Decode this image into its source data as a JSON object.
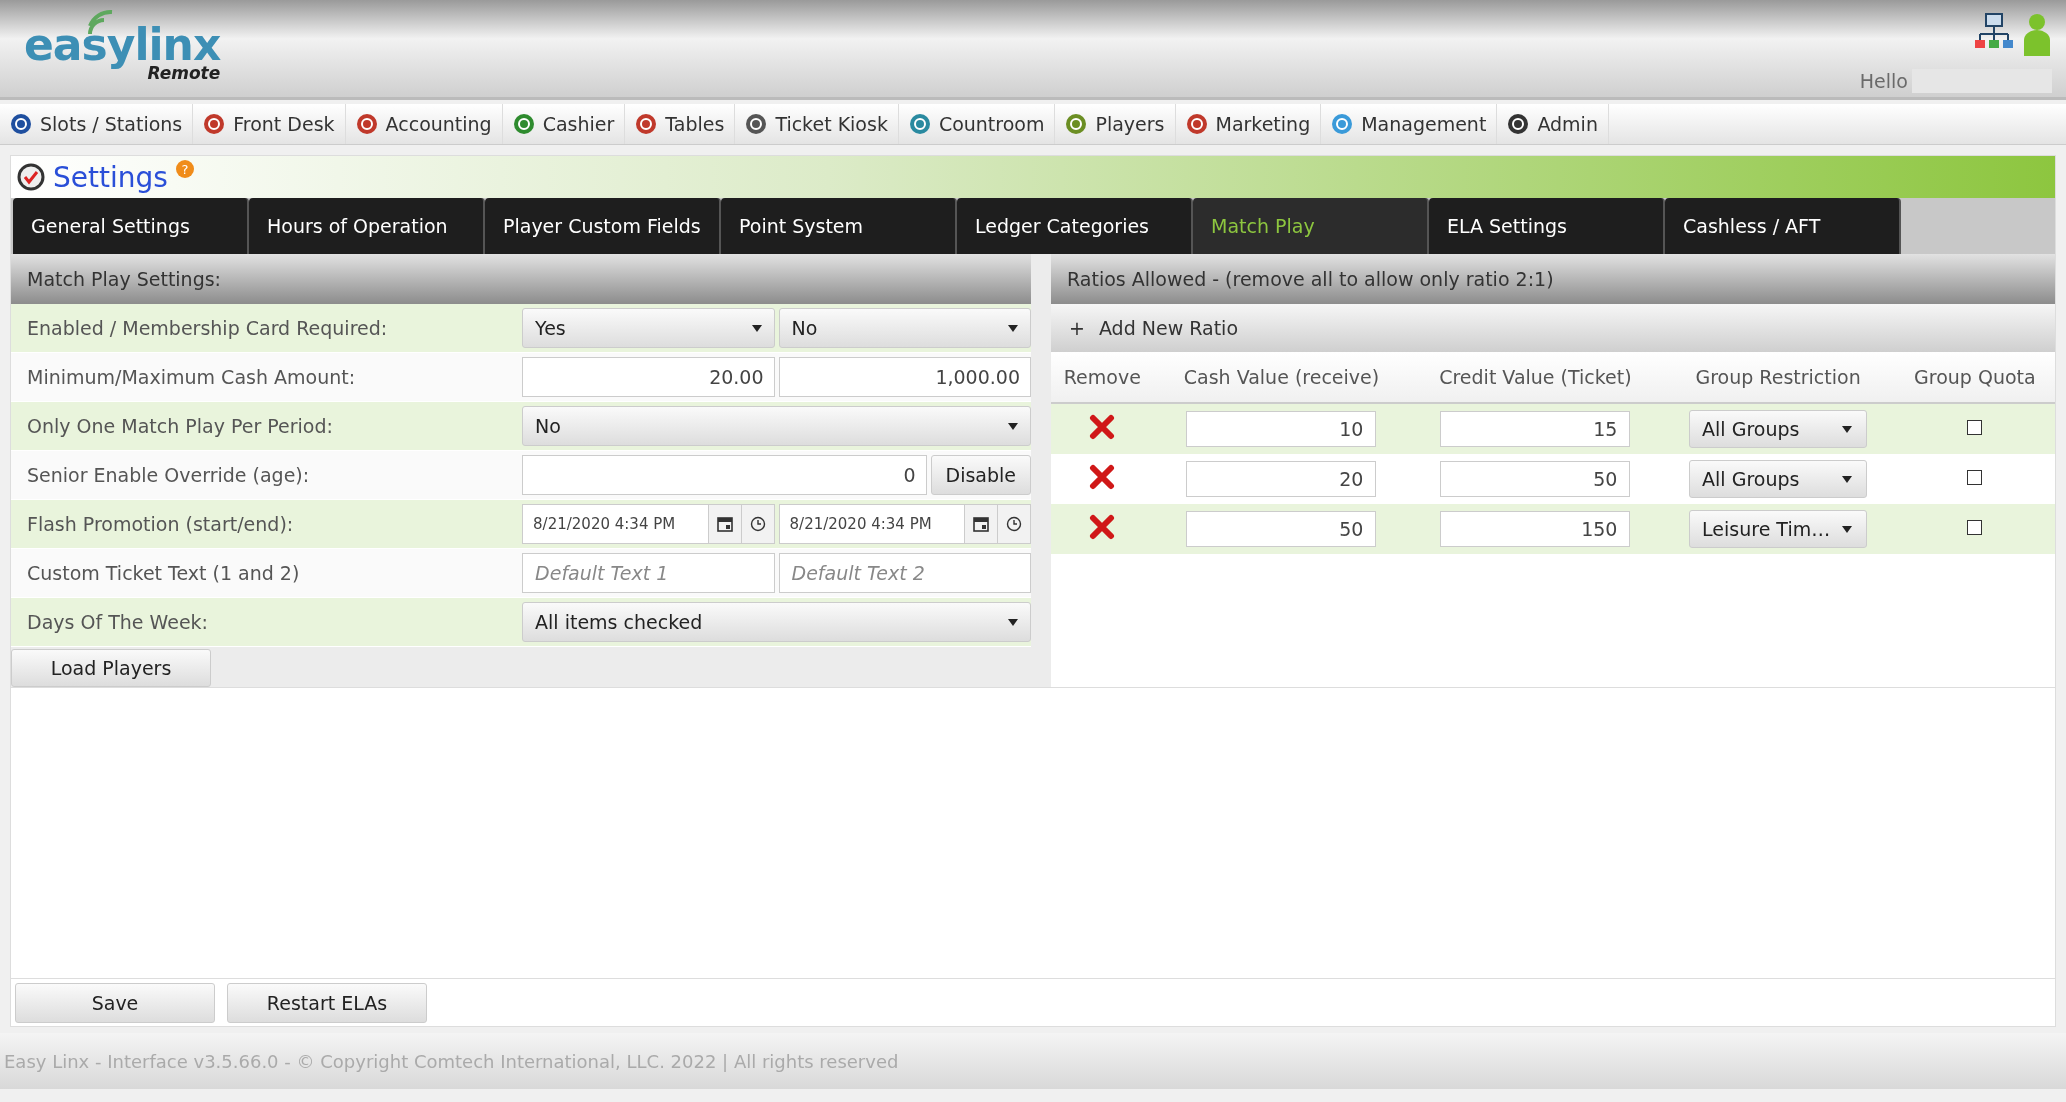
{
  "header": {
    "logo": {
      "main": "easylinx",
      "sub": "Remote"
    },
    "greeting": "Hello"
  },
  "nav": [
    {
      "label": "Slots / Stations"
    },
    {
      "label": "Front Desk"
    },
    {
      "label": "Accounting"
    },
    {
      "label": "Cashier"
    },
    {
      "label": "Tables"
    },
    {
      "label": "Ticket Kiosk"
    },
    {
      "label": "Countroom"
    },
    {
      "label": "Players"
    },
    {
      "label": "Marketing"
    },
    {
      "label": "Management"
    },
    {
      "label": "Admin"
    }
  ],
  "page": {
    "title": "Settings",
    "help": "?"
  },
  "tabs": [
    {
      "label": "General Settings",
      "selected": false
    },
    {
      "label": "Hours of Operation",
      "selected": false
    },
    {
      "label": "Player Custom Fields",
      "selected": false
    },
    {
      "label": "Point System",
      "selected": false
    },
    {
      "label": "Ledger Categories",
      "selected": false
    },
    {
      "label": "Match Play",
      "selected": true
    },
    {
      "label": "ELA Settings",
      "selected": false
    },
    {
      "label": "Cashless / AFT",
      "selected": false
    }
  ],
  "match_play": {
    "title": "Match Play Settings:",
    "rows": [
      {
        "label": "Enabled / Membership Card Required:",
        "fields": [
          {
            "kind": "select",
            "value": "Yes"
          },
          {
            "kind": "select",
            "value": "No"
          }
        ]
      },
      {
        "label": "Minimum/Maximum Cash Amount:",
        "fields": [
          {
            "kind": "number",
            "value": "20.00"
          },
          {
            "kind": "number",
            "value": "1,000.00"
          }
        ]
      },
      {
        "label": "Only One Match Play Per Period:",
        "fields": [
          {
            "kind": "select",
            "value": "No"
          }
        ]
      },
      {
        "label": "Senior Enable Override (age):",
        "fields": [
          {
            "kind": "number",
            "value": "0"
          },
          {
            "kind": "button",
            "value": "Disable"
          }
        ]
      },
      {
        "label": "Flash Promotion (start/end):",
        "fields": [
          {
            "kind": "datetime",
            "value": "8/21/2020 4:34 PM"
          },
          {
            "kind": "datetime",
            "value": "8/21/2020 4:34 PM"
          }
        ]
      },
      {
        "label": "Custom Ticket Text (1 and 2)",
        "fields": [
          {
            "kind": "text",
            "placeholder": "Default Text 1"
          },
          {
            "kind": "text",
            "placeholder": "Default Text 2"
          }
        ]
      },
      {
        "label": "Days Of The Week:",
        "fields": [
          {
            "kind": "select",
            "value": "All items checked"
          }
        ]
      }
    ],
    "load_button": "Load Players"
  },
  "ratios": {
    "title": "Ratios Allowed - (remove all to allow only ratio 2:1)",
    "add_icon": "+",
    "add_label": "Add New Ratio",
    "columns": [
      "Remove",
      "Cash Value (receive)",
      "Credit Value (Ticket)",
      "Group Restriction",
      "Group Quota"
    ],
    "rows": [
      {
        "cash": "10",
        "credit": "15",
        "group": "All Groups",
        "quota": false
      },
      {
        "cash": "20",
        "credit": "50",
        "group": "All Groups",
        "quota": false
      },
      {
        "cash": "50",
        "credit": "150",
        "group": "Leisure Tim…",
        "quota": false
      }
    ]
  },
  "buttons": [
    "Save",
    "Restart ELAs"
  ],
  "footer": "Easy Linx - Interface v3.5.66.0 - © Copyright Comtech International, LLC. 2022 | All rights reserved"
}
